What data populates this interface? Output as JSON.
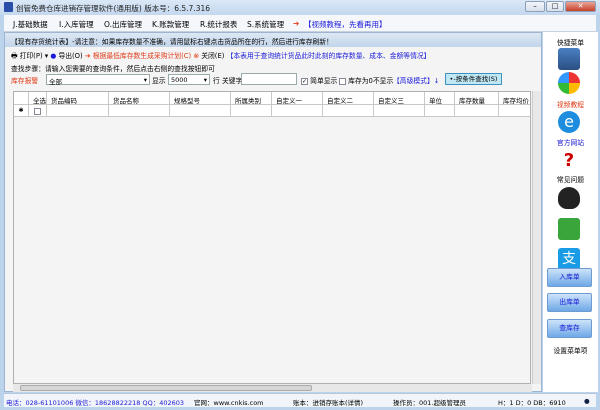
{
  "window": {
    "title": "创管免费仓库进销存管理软件(通用版) 版本号：6.5.7.316",
    "minimize": "–",
    "maximize": "□",
    "close": "✕"
  },
  "menu": [
    "J.基础数据",
    "I.入库管理",
    "O.出库管理",
    "K.账款管理",
    "R.统计报表",
    "S.系统管理"
  ],
  "menu_video": "【视频教程，先看再用】",
  "header": {
    "title": "【现有存货统计表】",
    "notice": "-请注意：如果库存数量不准确，请用鼠标右键点击货品所在的行，然后进行库存刷新！"
  },
  "toolbar": {
    "print": "打印(P)",
    "export": "导出(O)",
    "plan": "根据最低库存数生成采购计划(C)",
    "close": "关闭(E)",
    "info": "【本表用于查询统计货品此时此刻的库存数量、成本、金额等情况】"
  },
  "steps": "查找步骤：请输入您需要的查询条件，然后点击右侧的查找按钮即可",
  "filter": {
    "alarm_label": "库存报警",
    "alarm_value": "全部",
    "show_label": "显示",
    "show_value": "5000",
    "row_label": "行",
    "keyword_label": "关键字",
    "keyword_value": "",
    "simple_label": "简单显示",
    "simple_checked": true,
    "zero_label": "库存为0不显示",
    "zero_checked": false,
    "advanced": "【高级模式】↓",
    "search_btn": "•-按条件查找(S)"
  },
  "grid": {
    "columns": [
      "全选",
      "货品编码",
      "货品名称",
      "规格型号",
      "所属类别",
      "自定义一",
      "自定义二",
      "自定义三",
      "单位",
      "库存数量",
      "库存均价"
    ],
    "new_row_marker": "✱"
  },
  "sidebar": {
    "title": "快捷菜单",
    "video": "视频教程",
    "website": "官方网站",
    "faq": "常见问题",
    "in": "入库单",
    "out": "出库单",
    "stock": "查库存",
    "settings": "设置菜单项"
  },
  "status": {
    "contact": "电话：028-61101006 微信：18628822218 QQ：402603",
    "website": "官网：www.cnkis.com",
    "account": "账本：进销存账本(详情)",
    "operator": "操作员：001.超级管理员",
    "info": "H：1 D：0 DB：6910"
  }
}
